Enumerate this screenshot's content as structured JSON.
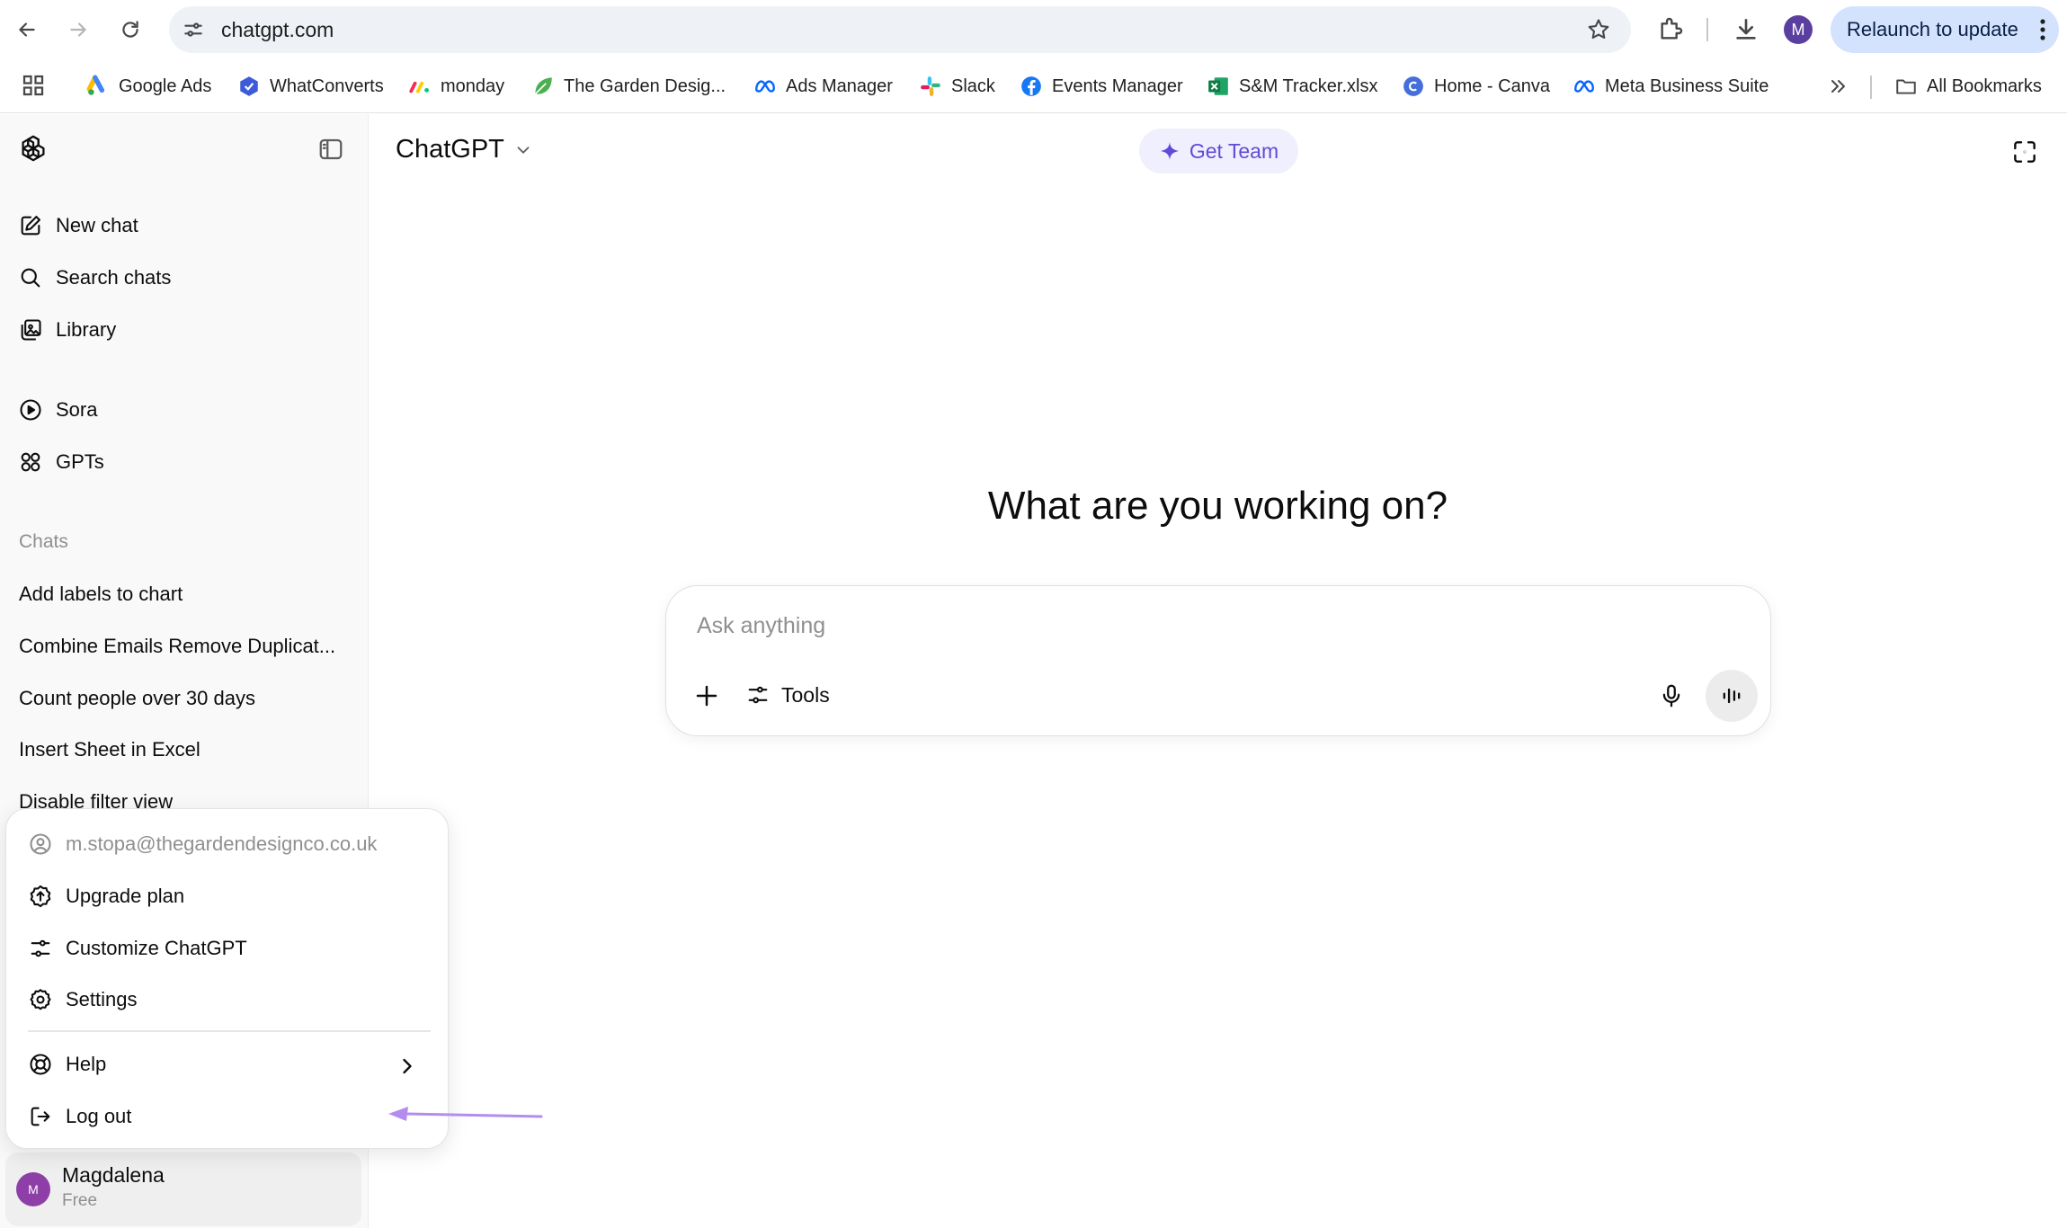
{
  "browser": {
    "url": "chatgpt.com",
    "relaunch_label": "Relaunch to update",
    "profile_initial": "M",
    "bookmarks": [
      {
        "label": "Google Ads",
        "icon": "google-ads-icon"
      },
      {
        "label": "WhatConverts",
        "icon": "whatconverts-icon"
      },
      {
        "label": "monday",
        "icon": "monday-icon"
      },
      {
        "label": "The Garden Desig...",
        "icon": "leaf-icon"
      },
      {
        "label": "Ads Manager",
        "icon": "meta-icon"
      },
      {
        "label": "Slack",
        "icon": "slack-icon"
      },
      {
        "label": "Events Manager",
        "icon": "facebook-icon"
      },
      {
        "label": "S&M Tracker.xlsx",
        "icon": "excel-icon"
      },
      {
        "label": "Home - Canva",
        "icon": "canva-icon"
      },
      {
        "label": "Meta Business Suite",
        "icon": "meta-icon"
      }
    ],
    "all_bookmarks_label": "All Bookmarks"
  },
  "sidebar": {
    "nav": [
      {
        "label": "New chat",
        "icon": "compose-icon"
      },
      {
        "label": "Search chats",
        "icon": "search-icon"
      },
      {
        "label": "Library",
        "icon": "library-icon"
      },
      {
        "label": "Sora",
        "icon": "play-icon"
      },
      {
        "label": "GPTs",
        "icon": "grid-icon"
      }
    ],
    "chats_heading": "Chats",
    "chats": [
      "Add labels to chart",
      "Combine Emails Remove Duplicat...",
      "Count people over 30 days",
      "Insert Sheet in Excel",
      "Disable filter view"
    ],
    "user": {
      "initial": "M",
      "name": "Magdalena",
      "plan": "Free"
    }
  },
  "account_menu": {
    "email": "m.stopa@thegardendesignco.co.uk",
    "items": [
      {
        "label": "Upgrade plan",
        "icon": "upgrade-icon"
      },
      {
        "label": "Customize ChatGPT",
        "icon": "sliders-icon"
      },
      {
        "label": "Settings",
        "icon": "gear-icon"
      },
      {
        "label": "Help",
        "icon": "help-icon"
      },
      {
        "label": "Log out",
        "icon": "logout-icon"
      }
    ]
  },
  "main": {
    "model_label": "ChatGPT",
    "get_team_label": "Get Team",
    "headline": "What are you working on?",
    "composer_placeholder": "Ask anything",
    "tools_label": "Tools"
  },
  "colors": {
    "accent_purple": "#5f4bd9",
    "annotation_arrow": "#b48cf0",
    "avatar": "#8e3fa7",
    "relaunch_bg": "#d3e3fd"
  }
}
